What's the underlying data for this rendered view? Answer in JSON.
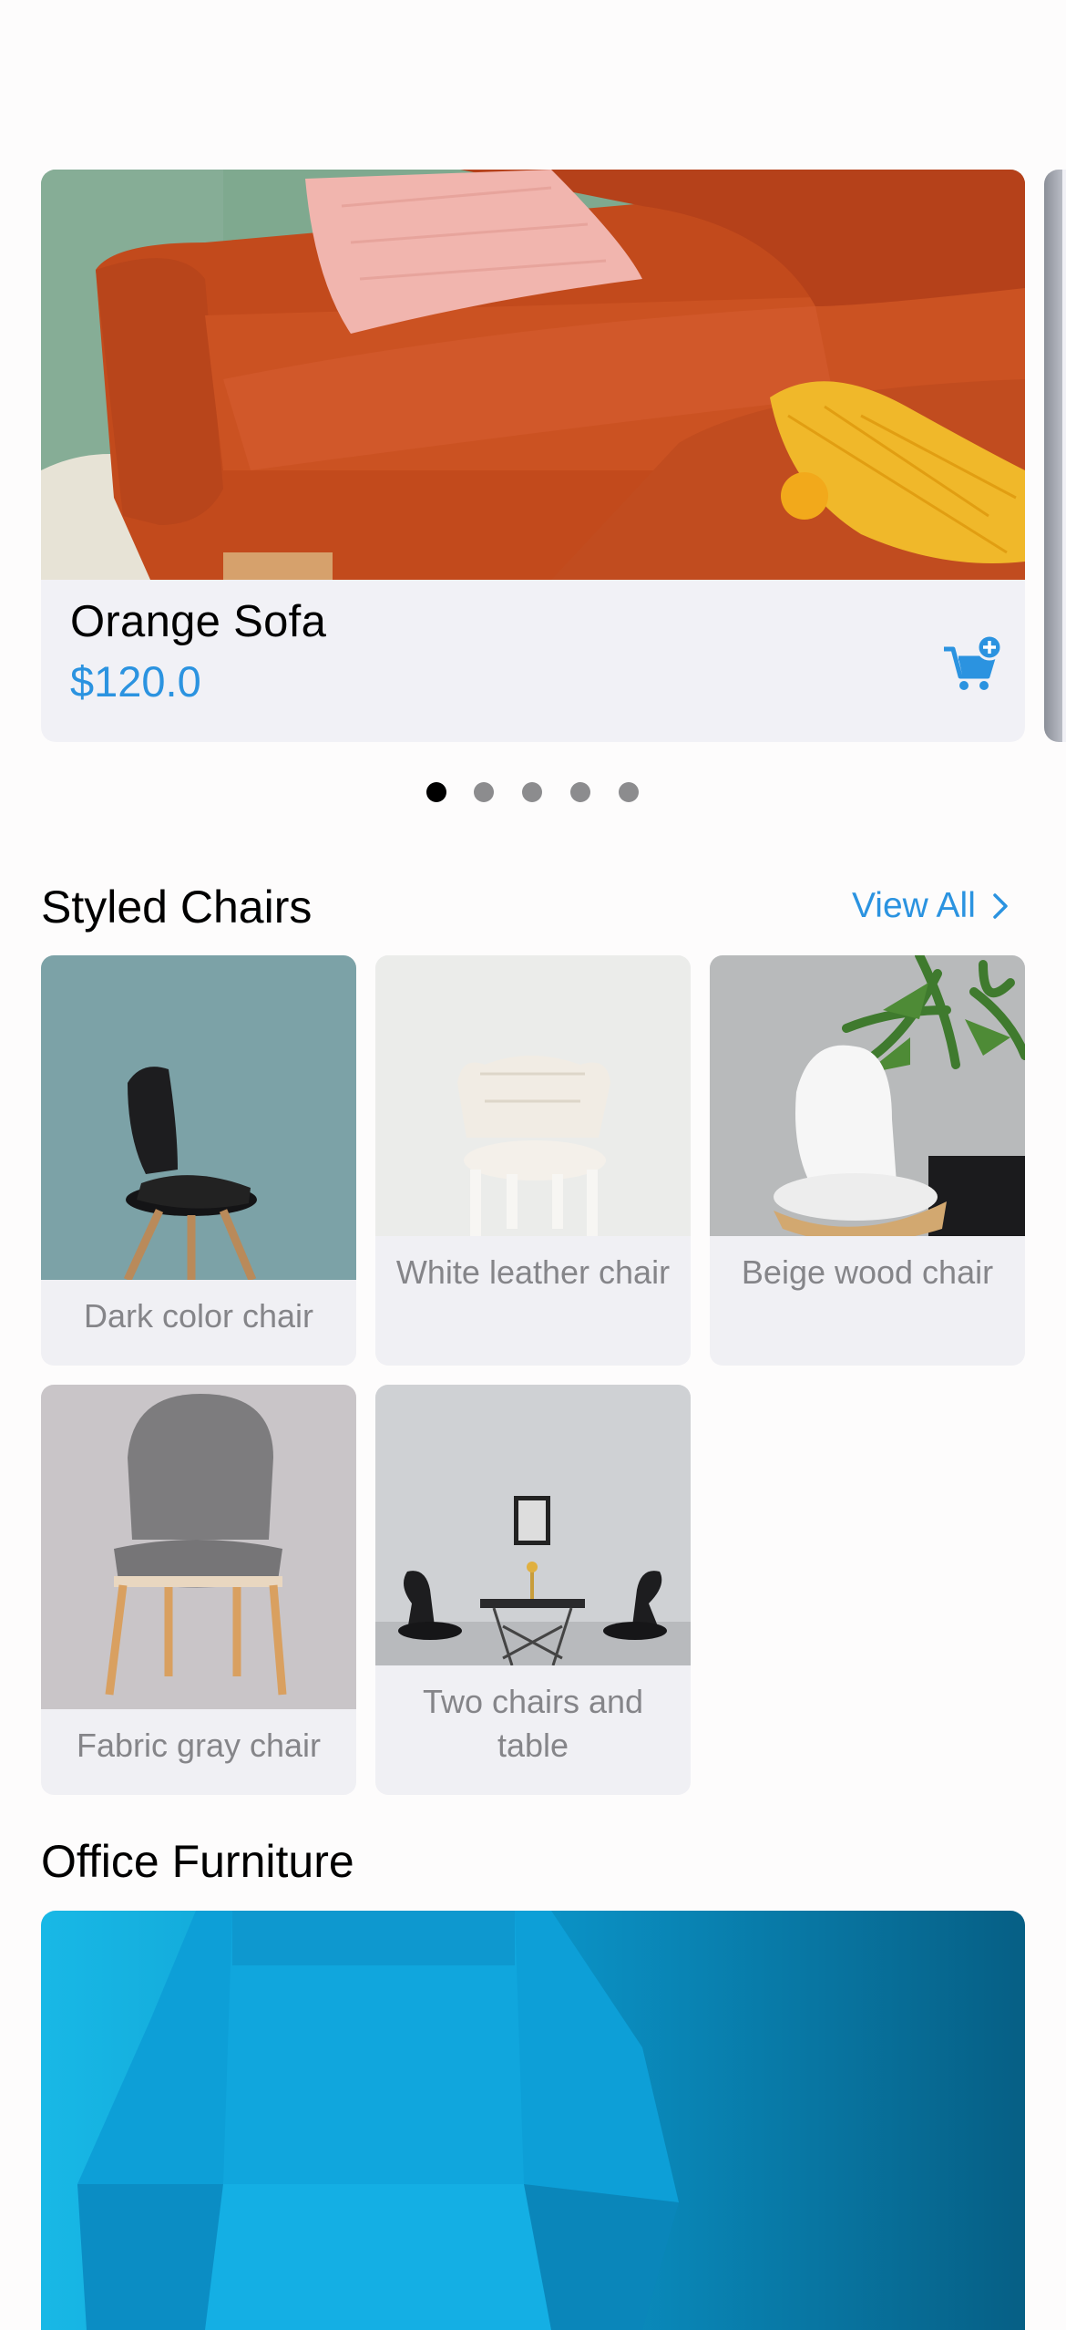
{
  "featured": {
    "title": "Orange Sofa",
    "price": "$120.0",
    "cart_icon": "cart-plus-icon",
    "accent_color": "#2b93e0"
  },
  "pager": {
    "count": 5,
    "active_index": 0
  },
  "styled_chairs": {
    "title": "Styled Chairs",
    "view_all_label": "View All",
    "items": [
      {
        "label": "Dark color chair"
      },
      {
        "label": "White leather chair"
      },
      {
        "label": "Beige wood chair"
      },
      {
        "label": "Fabric gray chair"
      },
      {
        "label": "Two chairs and table"
      }
    ]
  },
  "office_furniture": {
    "title": "Office Furniture"
  }
}
